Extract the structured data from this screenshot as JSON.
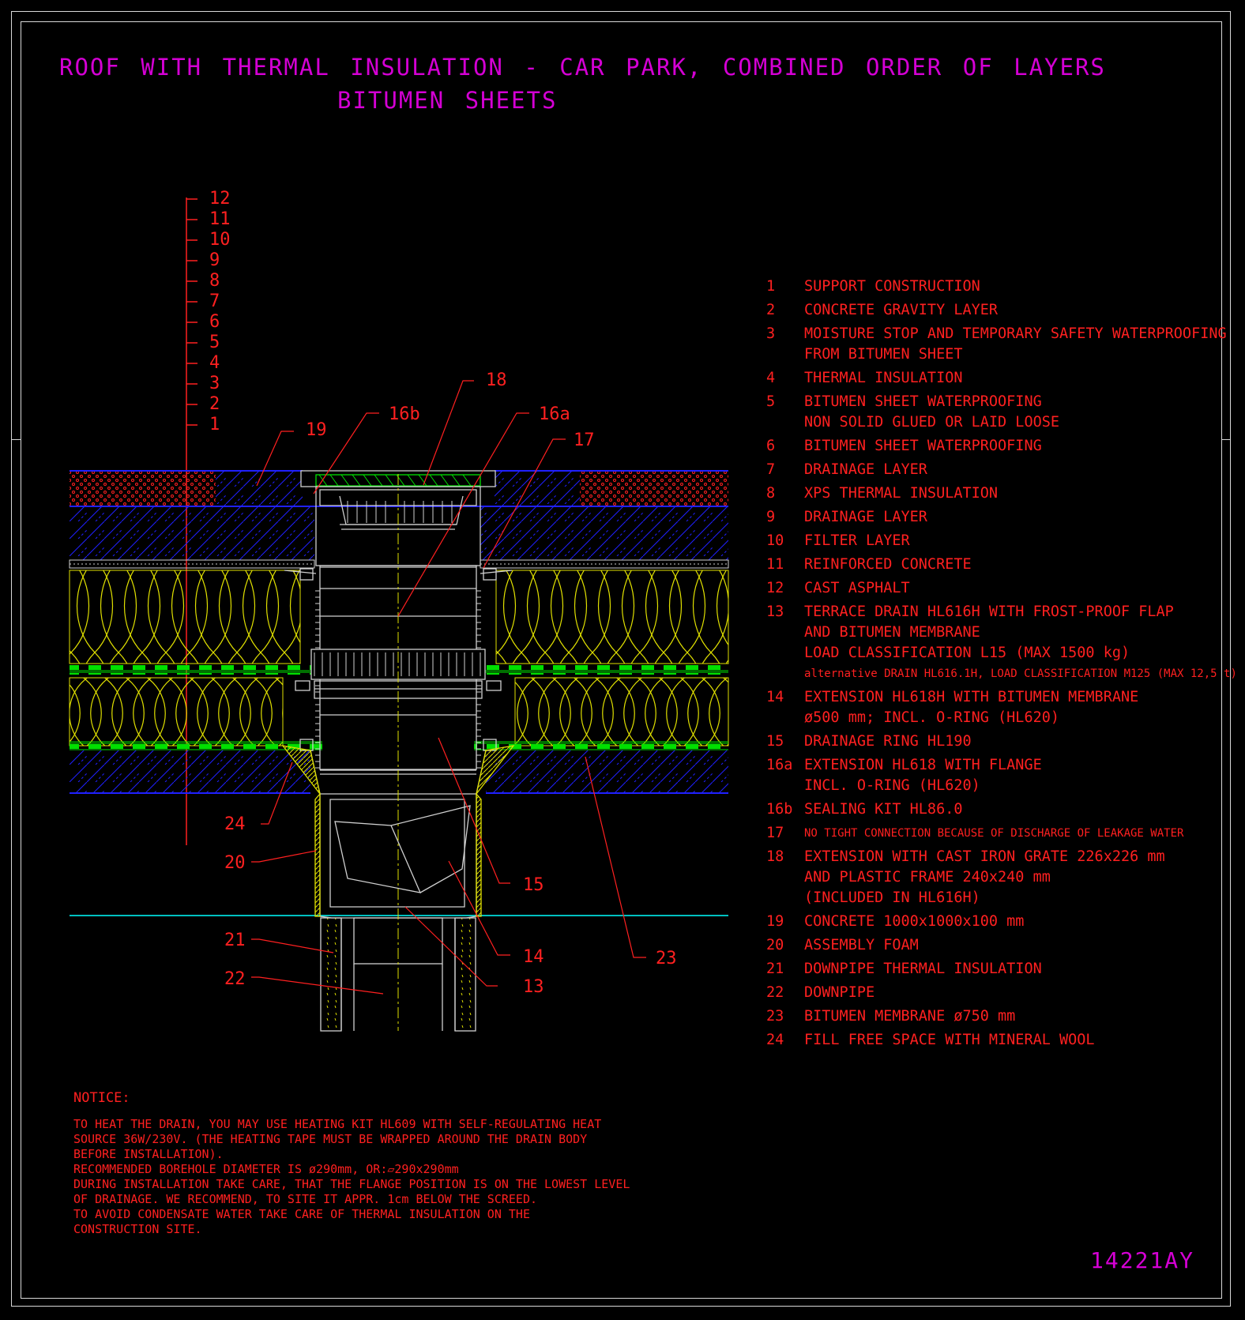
{
  "title": {
    "line1": "ROOF WITH THERMAL INSULATION - CAR PARK, COMBINED ORDER OF LAYERS",
    "line2": "BITUMEN SHEETS"
  },
  "layer_scale": [
    "12",
    "11",
    "10",
    "9",
    "8",
    "7",
    "6",
    "5",
    "4",
    "3",
    "2",
    "1"
  ],
  "callouts": [
    "19",
    "16b",
    "18",
    "16a",
    "17",
    "24",
    "20",
    "15",
    "14",
    "13",
    "21",
    "22",
    "23"
  ],
  "legend": [
    {
      "num": "1",
      "lines": [
        "SUPPORT CONSTRUCTION"
      ]
    },
    {
      "num": "2",
      "lines": [
        "CONCRETE GRAVITY LAYER"
      ]
    },
    {
      "num": "3",
      "lines": [
        "MOISTURE STOP AND TEMPORARY SAFETY WATERPROOFING",
        "FROM BITUMEN SHEET"
      ]
    },
    {
      "num": "4",
      "lines": [
        "THERMAL INSULATION"
      ]
    },
    {
      "num": "5",
      "lines": [
        "BITUMEN SHEET WATERPROOFING",
        "NON SOLID GLUED OR LAID LOOSE"
      ]
    },
    {
      "num": "6",
      "lines": [
        "BITUMEN SHEET WATERPROOFING"
      ]
    },
    {
      "num": "7",
      "lines": [
        "DRAINAGE LAYER"
      ]
    },
    {
      "num": "8",
      "lines": [
        "XPS THERMAL INSULATION"
      ]
    },
    {
      "num": "9",
      "lines": [
        "DRAINAGE LAYER"
      ]
    },
    {
      "num": "10",
      "lines": [
        "FILTER LAYER"
      ]
    },
    {
      "num": "11",
      "lines": [
        "REINFORCED CONCRETE"
      ]
    },
    {
      "num": "12",
      "lines": [
        "CAST ASPHALT"
      ]
    },
    {
      "num": "13",
      "lines": [
        "TERRACE DRAIN HL616H WITH FROST-PROOF FLAP",
        "AND BITUMEN MEMBRANE",
        "LOAD CLASSIFICATION L15 (MAX 1500 kg)"
      ],
      "small_line": "alternative DRAIN HL616.1H, LOAD CLASSIFICATION M125 (MAX 12,5 t)"
    },
    {
      "num": "14",
      "lines": [
        "EXTENSION HL618H WITH BITUMEN MEMBRANE",
        "ø500 mm; INCL. O-RING (HL620)"
      ]
    },
    {
      "num": "15",
      "lines": [
        "DRAINAGE RING HL190"
      ]
    },
    {
      "num": "16a",
      "lines": [
        "EXTENSION HL618 WITH FLANGE",
        "INCL. O-RING (HL620)"
      ]
    },
    {
      "num": "16b",
      "lines": [
        "SEALING KIT HL86.0"
      ]
    },
    {
      "num": "17",
      "lines": [],
      "small_line": "NO TIGHT CONNECTION BECAUSE OF DISCHARGE OF LEAKAGE WATER"
    },
    {
      "num": "18",
      "lines": [
        "EXTENSION WITH CAST IRON GRATE 226x226 mm",
        "AND PLASTIC FRAME 240x240 mm",
        "(INCLUDED IN HL616H)"
      ]
    },
    {
      "num": "19",
      "lines": [
        "CONCRETE 1000x1000x100 mm"
      ]
    },
    {
      "num": "20",
      "lines": [
        "ASSEMBLY FOAM"
      ]
    },
    {
      "num": "21",
      "lines": [
        "DOWNPIPE THERMAL INSULATION"
      ]
    },
    {
      "num": "22",
      "lines": [
        "DOWNPIPE"
      ]
    },
    {
      "num": "23",
      "lines": [
        "BITUMEN MEMBRANE ø750 mm"
      ]
    },
    {
      "num": "24",
      "lines": [
        "FILL FREE SPACE WITH MINERAL WOOL"
      ]
    }
  ],
  "notice": {
    "title": "NOTICE:",
    "lines": [
      "TO HEAT THE DRAIN, YOU MAY USE HEATING KIT HL609 WITH SELF-REGULATING HEAT",
      "SOURCE 36W/230V. (THE HEATING TAPE MUST BE WRAPPED AROUND THE DRAIN BODY",
      "BEFORE INSTALLATION).",
      "RECOMMENDED BOREHOLE DIAMETER IS ø290mm, OR:▱290x290mm",
      "DURING INSTALLATION TAKE CARE, THAT THE FLANGE POSITION IS ON THE LOWEST LEVEL",
      "OF DRAINAGE. WE RECOMMEND, TO SITE IT APPR. 1cm BELOW THE SCREED.",
      "TO AVOID CONDENSATE WATER TAKE CARE OF THERMAL INSULATION ON THE",
      "CONSTRUCTION SITE."
    ]
  },
  "drawing_code": "14221AY",
  "colors": {
    "background": "#000000",
    "title": "#d400d4",
    "text": "#ff2020",
    "insulation": "#e0e000",
    "concrete_hatch": "#2020ff",
    "membrane": "#00e000",
    "asphalt": "#ff2020",
    "pipe": "#d0d0d0",
    "screed_line": "#00c0c0"
  }
}
